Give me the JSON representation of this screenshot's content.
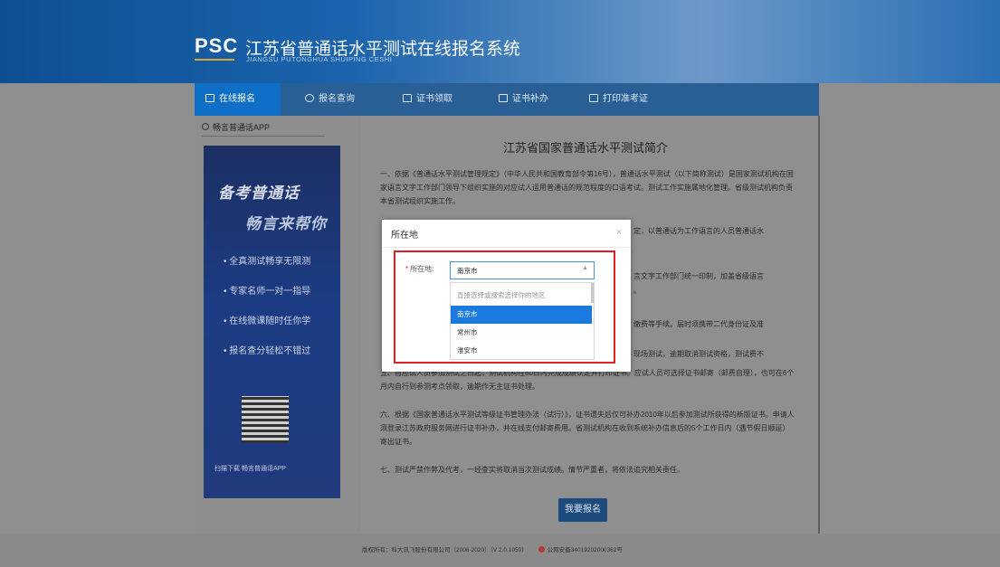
{
  "header": {
    "logo_main": "PS",
    "logo_accent": "C",
    "title": "江苏省普通话水平测试在线报名系统",
    "subtitle": "JIANGSU PUTONGHUA SHUIPING CESHI"
  },
  "nav": [
    {
      "label": "在线报名",
      "icon": "edit-icon",
      "active": true
    },
    {
      "label": "报名查询",
      "icon": "search-icon"
    },
    {
      "label": "证书领取",
      "icon": "certificate-icon"
    },
    {
      "label": "证书补办",
      "icon": "certificate-icon"
    },
    {
      "label": "打印准考证",
      "icon": "printer-icon"
    }
  ],
  "sidebar": {
    "app_link": "畅言普通话APP",
    "banner_title_1": "备考普通话",
    "banner_title_2": "畅言来帮你",
    "features": [
      "• 全真测试畅享无限测",
      "• 专家名师一对一指导",
      "• 在线微课随时任你学",
      "• 报名查分轻松不错过"
    ],
    "qr_caption": "扫描下载 畅言普通话APP"
  },
  "main": {
    "title": "江苏省国家普通话水平测试简介",
    "para1": "一、依据《普通话水平测试管理规定》（中华人民共和国教育部令第16号），普通话水平测试（以下简称测试）是国家测试机构在国家语言文字工作部门领导下组织实施的对应试人运用普通话的规范程度的口语考试。测试工作实施属地化管理。省级测试机构负责本省测试组织实施工作。",
    "frag2": "定，以普通话为工作语言的人员普通话水",
    "frag3a": "言文字工作部门统一印制，加盖省级语言",
    "frag3b": "。",
    "frag4a": "缴费等手续。届时须携带二代身份证及准",
    "frag4b": "现场测试，逾期取消测试资格，测试费不",
    "para5": "五、自应试人员参加测试之日起，测试机构在60日内完成成绩认定并打印证书。应试人员可选择证书邮寄（邮费自理），也可在6个月内自行到参测考点领取，逾期作无主证书处理。",
    "para6": "六、根据《国家普通话水平测试等级证书管理办法（试行）》，证书遗失后仅可补办2010年以后参加测试所获得的新版证书。申请人须登录江苏政府服务网进行证书补办，并在线支付邮寄费用。省测试机构在收到系统补办信息后的5个工作日内（遇节假日顺延）寄出证书。",
    "para7": "七、测试严禁作弊及代考，一经查实将取消当次测试成绩。情节严重者，将依法追究相关责任。",
    "signup_button": "我要报名"
  },
  "dialog": {
    "title": "所在地",
    "close": "×",
    "field_label": "所在地:",
    "required_mark": "*",
    "select_value": "南京市",
    "options": [
      "直接选择或搜索选择你的地区",
      "南京市",
      "常州市",
      "淮安市"
    ],
    "selected_index": 1
  },
  "footer": {
    "copyright": "版权所有：科大讯飞股份有限公司（2006-2020）（V 2.0.1059）",
    "police": "公网安备34019202000362号"
  },
  "colors": {
    "nav_active": "#0f6fc7",
    "highlight": "#e02020",
    "selected_option": "#1a7ae0"
  }
}
